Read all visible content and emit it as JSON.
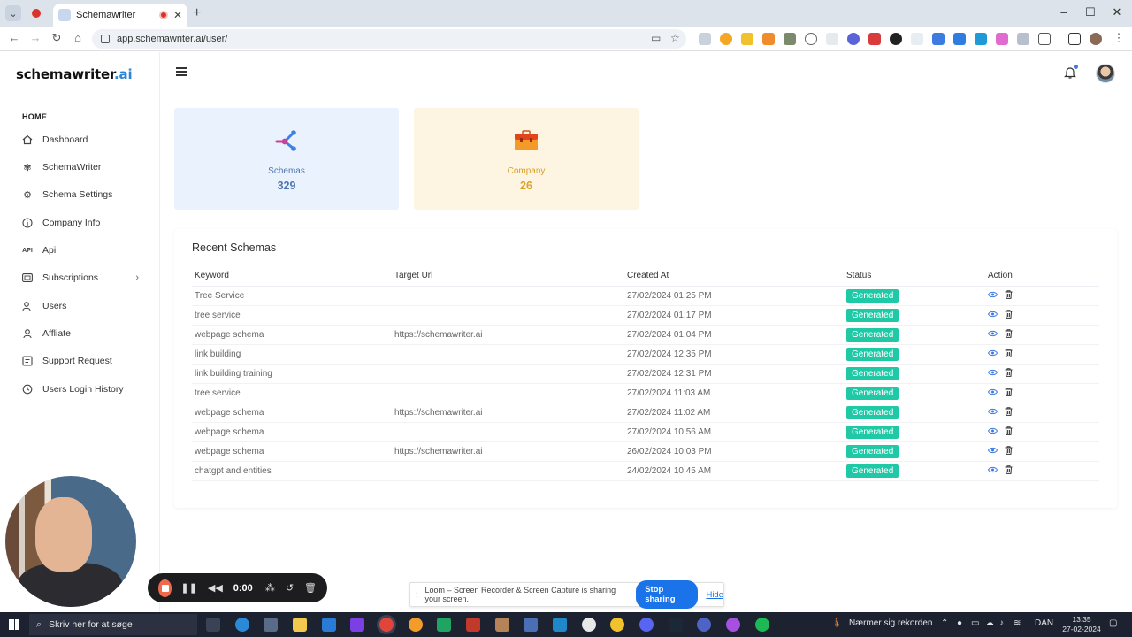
{
  "browser": {
    "tab_title": "Schemawriter",
    "url": "app.schemawriter.ai/user/"
  },
  "brand": {
    "name": "schemawriter",
    "suffix": ".ai"
  },
  "sidebar": {
    "section": "HOME",
    "items": [
      {
        "label": "Dashboard",
        "icon": "home-icon"
      },
      {
        "label": "SchemaWriter",
        "icon": "flower-icon"
      },
      {
        "label": "Schema Settings",
        "icon": "gear-icon"
      },
      {
        "label": "Company Info",
        "icon": "info-icon"
      },
      {
        "label": "Api",
        "icon": "api-icon"
      },
      {
        "label": "Subscriptions",
        "icon": "card-icon"
      },
      {
        "label": "Users",
        "icon": "users-icon"
      },
      {
        "label": "Affliate",
        "icon": "user-icon"
      },
      {
        "label": "Support Request",
        "icon": "ticket-icon"
      },
      {
        "label": "Users Login History",
        "icon": "history-icon"
      }
    ]
  },
  "cards": {
    "schemas": {
      "label": "Schemas",
      "value": "329"
    },
    "company": {
      "label": "Company",
      "value": "26"
    }
  },
  "recent": {
    "title": "Recent Schemas",
    "headers": {
      "keyword": "Keyword",
      "url": "Target Url",
      "created": "Created At",
      "status": "Status",
      "action": "Action"
    },
    "rows": [
      {
        "keyword": "Tree Service",
        "url": "",
        "created": "27/02/2024 01:25 PM",
        "status": "Generated"
      },
      {
        "keyword": "tree service",
        "url": "",
        "created": "27/02/2024 01:17 PM",
        "status": "Generated"
      },
      {
        "keyword": "webpage schema",
        "url": "https://schemawriter.ai",
        "created": "27/02/2024 01:04 PM",
        "status": "Generated"
      },
      {
        "keyword": "link building",
        "url": "",
        "created": "27/02/2024 12:35 PM",
        "status": "Generated"
      },
      {
        "keyword": "link building training",
        "url": "",
        "created": "27/02/2024 12:31 PM",
        "status": "Generated"
      },
      {
        "keyword": "tree service",
        "url": "",
        "created": "27/02/2024 11:03 AM",
        "status": "Generated"
      },
      {
        "keyword": "webpage schema",
        "url": "https://schemawriter.ai",
        "created": "27/02/2024 11:02 AM",
        "status": "Generated"
      },
      {
        "keyword": "webpage schema",
        "url": "",
        "created": "27/02/2024 10:56 AM",
        "status": "Generated"
      },
      {
        "keyword": "webpage schema",
        "url": "https://schemawriter.ai",
        "created": "26/02/2024 10:03 PM",
        "status": "Generated"
      },
      {
        "keyword": "chatgpt and entities",
        "url": "",
        "created": "24/02/2024 10:45 AM",
        "status": "Generated"
      }
    ]
  },
  "loom": {
    "timer": "0:00",
    "share_message": "Loom – Screen Recorder & Screen Capture is sharing your screen.",
    "stop_label": "Stop sharing",
    "hide_label": "Hide"
  },
  "taskbar": {
    "search_placeholder": "Skriv her for at søge",
    "weather": "Nærmer sig rekorden",
    "lang": "DAN",
    "time": "13:35",
    "date": "27-02-2024"
  },
  "colors": {
    "accent": "#2b86d6",
    "badge": "#20c9a6",
    "schemas_card": "#eaf2fd",
    "company_card": "#fdf4e2",
    "stop_button": "#1a73e8"
  }
}
